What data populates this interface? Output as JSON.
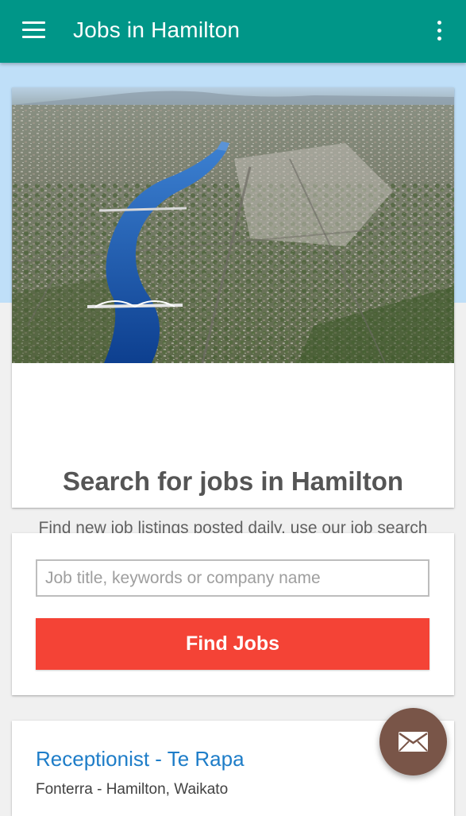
{
  "app_bar": {
    "title": "Jobs in Hamilton",
    "menu_icon": "hamburger-menu-icon",
    "overflow_icon": "more-vertical-icon"
  },
  "hero": {
    "image_subject": "aerial-city-river-photo",
    "heading": "Search for jobs in Hamilton",
    "description": "Find new job listings posted daily, use our job search tool to find a job in your local area."
  },
  "search": {
    "placeholder": "Job title, keywords or company name",
    "value": "",
    "button_label": "Find Jobs"
  },
  "listings": [
    {
      "title": "Receptionist - Te Rapa",
      "meta": "Fonterra - Hamilton, Waikato"
    }
  ],
  "fab": {
    "icon": "mail-icon"
  },
  "colors": {
    "primary": "#009688",
    "accent_button": "#f44336",
    "fab": "#795548",
    "link": "#1e7dc8",
    "hero_band": "#bfdff8"
  }
}
